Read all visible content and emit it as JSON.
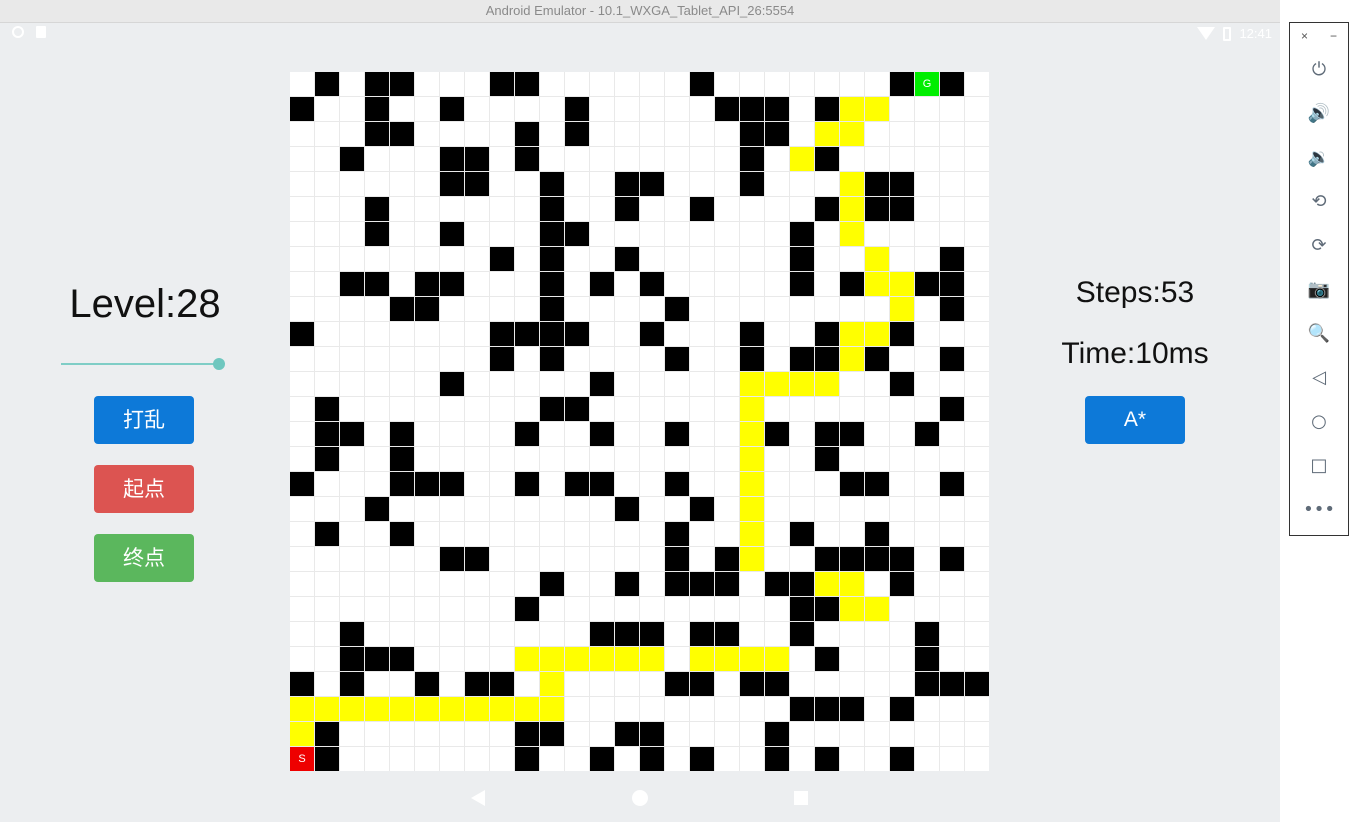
{
  "window": {
    "title": "Android Emulator - 10.1_WXGA_Tablet_API_26:5554"
  },
  "status_bar": {
    "time": "12:41"
  },
  "left_panel": {
    "level_text": "Level:28",
    "slider_value_fraction": 1.0,
    "buttons": {
      "shuffle": "打乱",
      "start": "起点",
      "end": "终点"
    }
  },
  "right_panel": {
    "steps_text": "Steps:53",
    "time_text": "Time:10ms",
    "astar_button": "A*"
  },
  "maze": {
    "rows": 28,
    "cols": 28,
    "start_label": "S",
    "goal_label": "G",
    "colors": {
      "wall": "#000000",
      "free": "#ffffff",
      "path": "#ffff00",
      "start": "#ee0000",
      "goal": "#00ee00",
      "grid": "#e9e9e9"
    },
    "legend": {
      ".": "free",
      "#": "wall",
      "*": "path",
      "S": "start",
      "G": "goal"
    },
    "grid": [
      ".#.##...##......#.......#G#",
      "#..#..#....#.....###.#**...",
      "...##....#.#......##.**....",
      "..#...##.#........#.*#.....",
      "......##..#..##...#...*##..",
      "...#......#..#..#....#*##..",
      "...#..#...##........#.*....",
      "........#.#..#......#..*..#",
      "..##.##...#.#.#.....#.#**##",
      "....##....#....#........*.#",
      "#.......####..#...#..#**#..",
      "........#.#....#..#.##*#..#",
      "......#.....#.....****..#..",
      ".#........##......*.......#",
      ".##.#....#..#..#..*#.##..#.",
      ".#..#.............*..#.....",
      "#...###..#.##..#..*...##..#",
      "...#.........#..#.*........",
      ".#..#..........#..*.#..#...",
      "......##.......#.#*..####.#",
      "..........#..#.###.##**.#..",
      ".........#..........##**....",
      "..#.........###.##..#....#.",
      "..###....******.****.#...#.",
      "#.#..#.##.*....##.##.....###",
      "***********.........###.#..",
      "*#.......##..##....#.......",
      "S#.......#..#.#.#..#.#..#.."
    ]
  },
  "nav_bar": {
    "icons": [
      "back-icon",
      "home-icon",
      "recents-icon"
    ]
  },
  "emulator_toolbar": {
    "top_controls": {
      "close": "×",
      "minimize": "−"
    },
    "items": [
      {
        "name": "power-icon",
        "glyph": "⏻"
      },
      {
        "name": "volume-up-icon",
        "glyph": "🔊"
      },
      {
        "name": "volume-down-icon",
        "glyph": "🔉"
      },
      {
        "name": "rotate-left-icon",
        "glyph": "⟲"
      },
      {
        "name": "rotate-right-icon",
        "glyph": "⟳"
      },
      {
        "name": "camera-icon",
        "glyph": "📷"
      },
      {
        "name": "zoom-icon",
        "glyph": "🔍"
      },
      {
        "name": "back-icon",
        "glyph": "◁"
      },
      {
        "name": "home-icon",
        "glyph": "○"
      },
      {
        "name": "overview-icon",
        "glyph": "□"
      },
      {
        "name": "more-icon",
        "glyph": "•••"
      }
    ]
  }
}
